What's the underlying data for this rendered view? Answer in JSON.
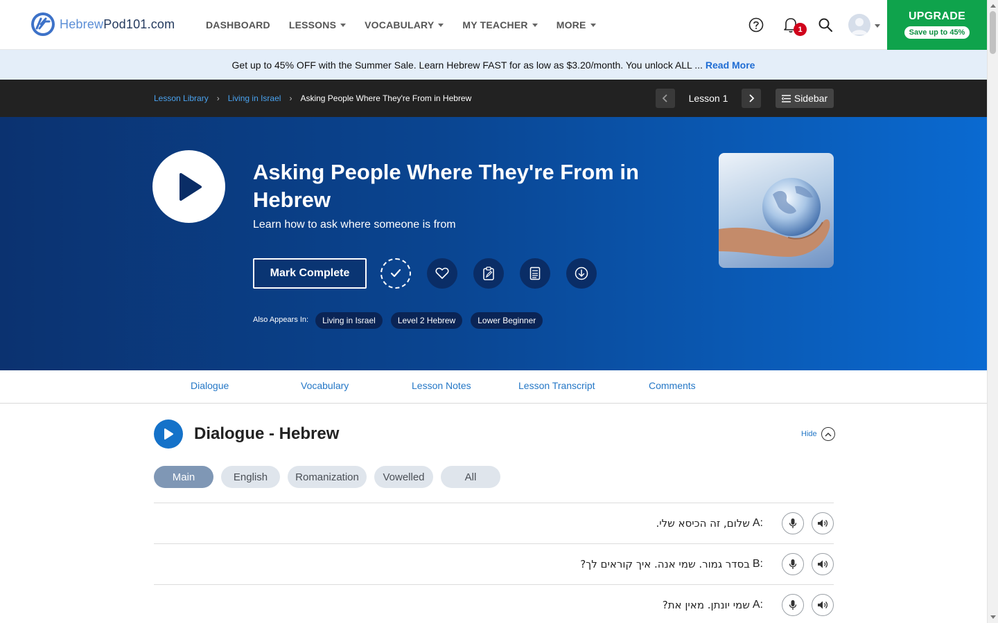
{
  "brand": {
    "prefix": "Hebrew",
    "suffix": "Pod101.com"
  },
  "nav": {
    "items": [
      {
        "label": "DASHBOARD",
        "dropdown": false
      },
      {
        "label": "LESSONS",
        "dropdown": true
      },
      {
        "label": "VOCABULARY",
        "dropdown": true
      },
      {
        "label": "MY TEACHER",
        "dropdown": true
      },
      {
        "label": "MORE",
        "dropdown": true
      }
    ],
    "notification_count": "1",
    "upgrade_title": "UPGRADE",
    "upgrade_sub": "Save up to 45%"
  },
  "promo": {
    "text": "Get up to 45% OFF with the Summer Sale. Learn Hebrew FAST for as low as $3.20/month. You unlock ALL ...",
    "link": "Read More"
  },
  "breadcrumb": {
    "items": [
      "Lesson Library",
      "Living in Israel"
    ],
    "current": "Asking People Where They're From in Hebrew"
  },
  "lesson_nav": {
    "label": "Lesson 1",
    "sidebar": "Sidebar"
  },
  "hero": {
    "title": "Asking People Where They're From in Hebrew",
    "subtitle": "Learn how to ask where someone is from",
    "mark_complete": "Mark Complete",
    "also_label": "Also Appears In:",
    "tags": [
      "Living in Israel",
      "Level 2 Hebrew",
      "Lower Beginner"
    ]
  },
  "tabs": [
    "Dialogue",
    "Vocabulary",
    "Lesson Notes",
    "Lesson Transcript",
    "Comments"
  ],
  "dialogue": {
    "title": "Dialogue - Hebrew",
    "hide_label": "Hide",
    "pills": [
      "Main",
      "English",
      "Romanization",
      "Vowelled",
      "All"
    ],
    "active_pill": "Main",
    "lines": [
      {
        "speaker": "A",
        "text": "שלום, זה הכיסא שלי."
      },
      {
        "speaker": "B",
        "text": "בסדר גמור. שמי אנה. איך קוראים לך?"
      },
      {
        "speaker": "A",
        "text": "שמי יונתן. מאין את?"
      }
    ]
  },
  "colors": {
    "accent_blue": "#1572c9",
    "upgrade_green": "#0fa34c",
    "hero_dark": "#0b3270",
    "hero_light": "#0a6ad1",
    "promo_bg": "#e4eef9",
    "badge_red": "#d0021b"
  }
}
